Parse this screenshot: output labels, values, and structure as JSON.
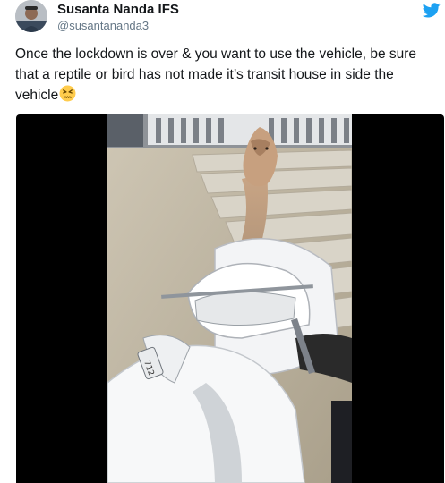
{
  "tweet": {
    "author_name": "Susanta Nanda IFS",
    "author_handle": "@susantananda3",
    "text": "Once the lockdown is over & you want to use the vehicle, be sure that a reptile or bird has not made it’s transit house in side the vehicle",
    "emoji": "persevering-face-emoji"
  },
  "media": {
    "scooter_plate_text": "712"
  },
  "colors": {
    "text": "#14171a",
    "secondary_text": "#657786",
    "twitter_blue": "#1da1f2",
    "media_background": "#000000"
  }
}
